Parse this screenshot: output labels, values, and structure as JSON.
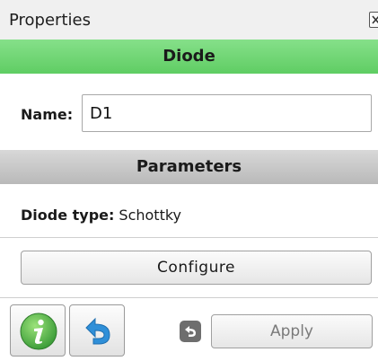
{
  "panel": {
    "title": "Properties"
  },
  "diode_section": {
    "header": "Diode",
    "name_label": "Name:",
    "name_value": "D1"
  },
  "parameters_section": {
    "header": "Parameters",
    "diode_type_label": "Diode type:",
    "diode_type_value": "Schottky"
  },
  "actions": {
    "configure_label": "Configure",
    "apply_label": "Apply"
  },
  "icons": {
    "close": "close-icon",
    "info": "info-icon",
    "undo": "undo-icon",
    "revert_small": "revert-icon"
  },
  "colors": {
    "header_green": "#6fd573",
    "header_gray": "#c8c8c8",
    "info_green": "#4caf50",
    "undo_blue": "#2f8fd8"
  }
}
